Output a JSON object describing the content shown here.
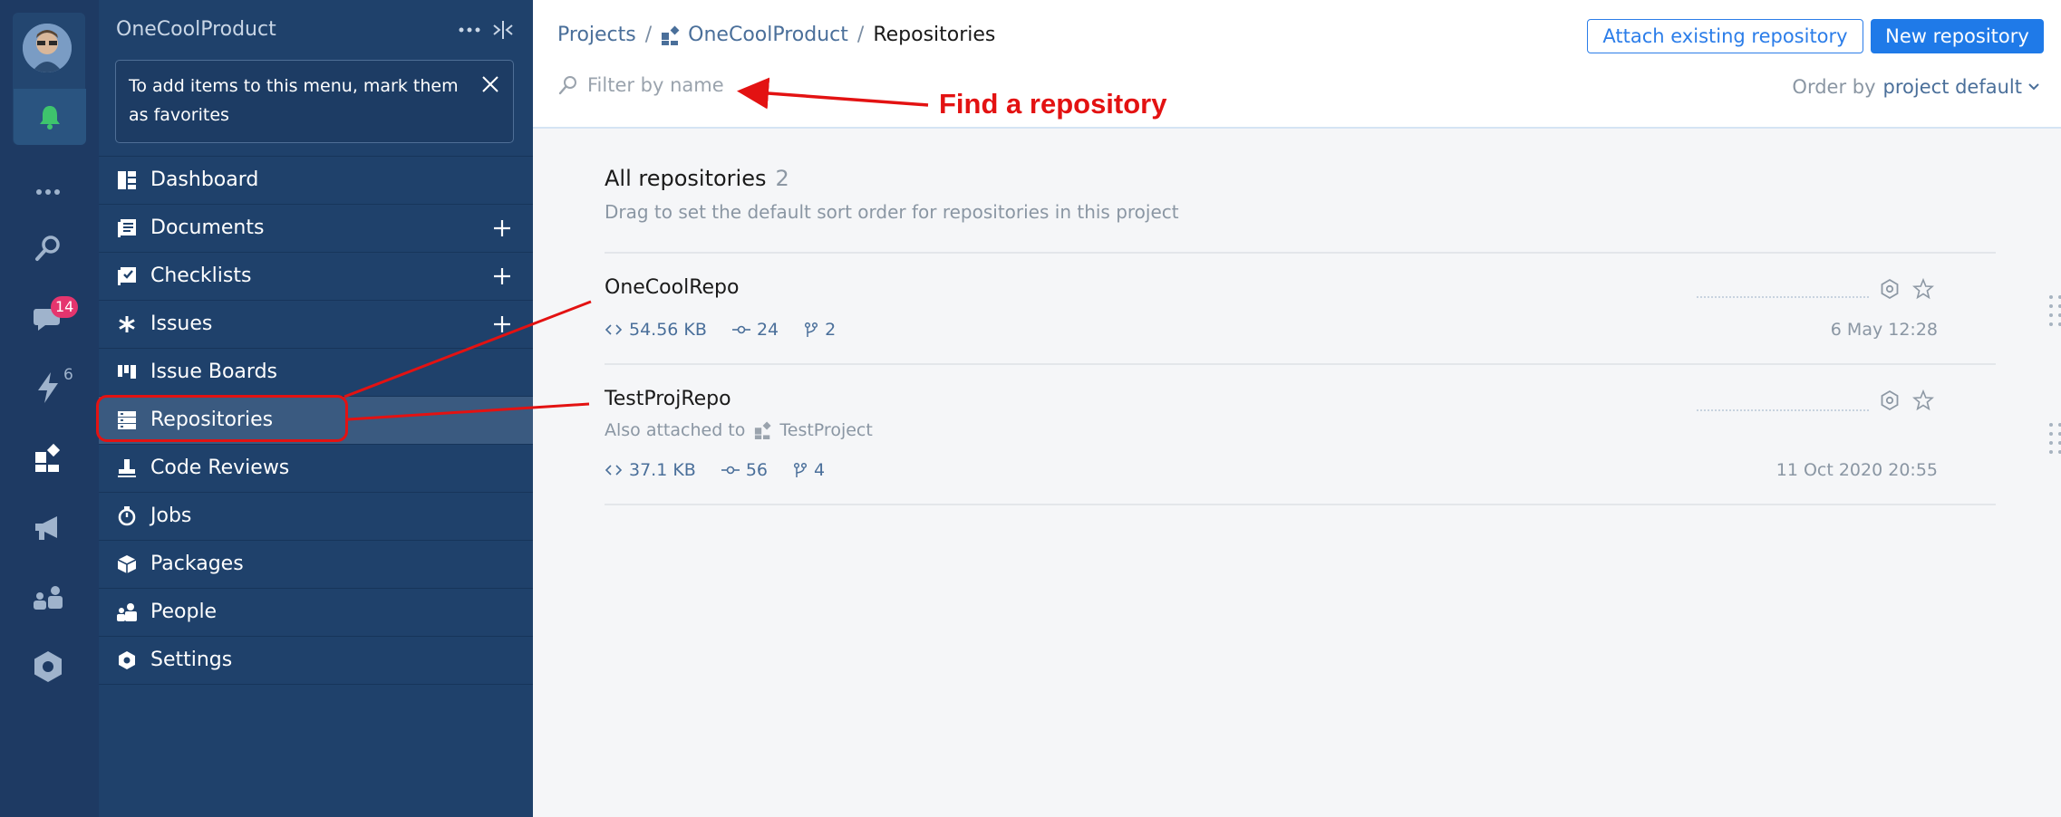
{
  "rail": {
    "chats_badge": "14",
    "automation_count": "6"
  },
  "sidebar": {
    "project_title": "OneCoolProduct",
    "hint": "To add items to this menu, mark them as favorites",
    "items": [
      {
        "label": "Dashboard"
      },
      {
        "label": "Documents"
      },
      {
        "label": "Checklists"
      },
      {
        "label": "Issues"
      },
      {
        "label": "Issue Boards"
      },
      {
        "label": "Repositories"
      },
      {
        "label": "Code Reviews"
      },
      {
        "label": "Jobs"
      },
      {
        "label": "Packages"
      },
      {
        "label": "People"
      },
      {
        "label": "Settings"
      }
    ]
  },
  "header": {
    "crumb_projects": "Projects",
    "crumb_sep1": "/",
    "crumb_project": "OneCoolProduct",
    "crumb_sep2": "/",
    "crumb_current": "Repositories",
    "attach_button": "Attach existing repository",
    "new_button": "New repository",
    "filter_placeholder": "Filter by name",
    "order_label": "Order by",
    "order_value": "project default"
  },
  "section": {
    "title": "All repositories",
    "count": "2",
    "subtitle": "Drag to set the default sort order for repositories in this project"
  },
  "repos": [
    {
      "name": "OneCoolRepo",
      "size": "54.56 KB",
      "commits": "24",
      "branches": "2",
      "date": "6 May 12:28"
    },
    {
      "name": "TestProjRepo",
      "attached_prefix": "Also attached to",
      "attached_project": "TestProject",
      "size": "37.1 KB",
      "commits": "56",
      "branches": "4",
      "date": "11 Oct 2020 20:55"
    }
  ],
  "annotation": {
    "text": "Find a repository",
    "color": "#e31212"
  },
  "colors": {
    "rail_bg": "#1e3a63",
    "sidebar_bg": "#1f416b",
    "accent": "#1f7ae8"
  }
}
